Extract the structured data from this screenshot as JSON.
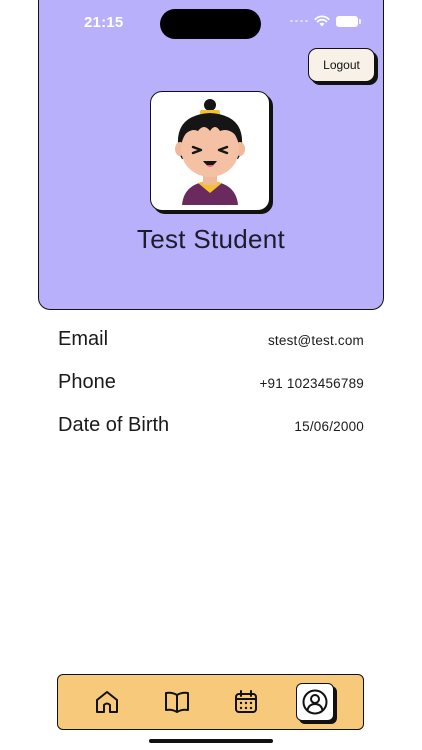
{
  "status_bar": {
    "time": "21:15"
  },
  "header": {
    "logout_label": "Logout",
    "student_name": "Test Student"
  },
  "profile": {
    "rows": [
      {
        "label": "Email",
        "value": "stest@test.com"
      },
      {
        "label": "Phone",
        "value": "+91 1023456789"
      },
      {
        "label": "Date of Birth",
        "value": "15/06/2000"
      }
    ]
  },
  "bottom_nav": {
    "items": [
      {
        "icon": "home-icon",
        "active": false
      },
      {
        "icon": "book-icon",
        "active": false
      },
      {
        "icon": "calendar-icon",
        "active": false
      },
      {
        "icon": "profile-icon",
        "active": true
      }
    ]
  },
  "colors": {
    "header_bg": "#b8b0fb",
    "nav_bg": "#f7c97a",
    "button_bg": "#f7f1e8"
  }
}
